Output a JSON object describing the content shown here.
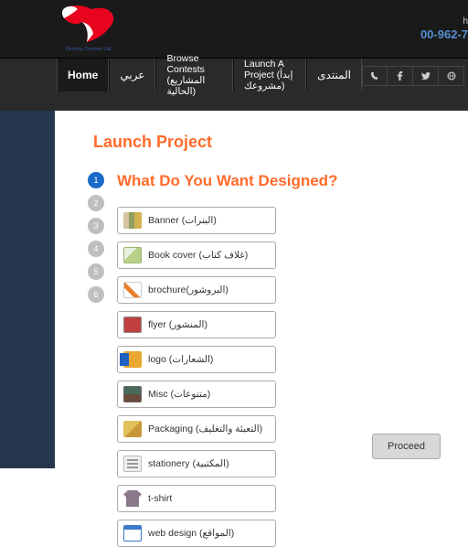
{
  "header": {
    "company": "Destiny Contest Ltd.",
    "phone": "00-962-7",
    "topright": "h"
  },
  "nav": {
    "items": [
      "Home",
      "عربي",
      "Browse Contests (المشاريع الحالية)",
      "Launch A Project (إبدأ مشروعك)",
      "المنتدى"
    ]
  },
  "page": {
    "title": "Launch Project",
    "step_title": "What Do You Want Designed?",
    "proceed": "Proceed"
  },
  "steps": [
    "1",
    "2",
    "3",
    "4",
    "5",
    "6"
  ],
  "categories": [
    {
      "label": "Banner (البنرات)",
      "thumb": "banner"
    },
    {
      "label": "Book cover (غلاف كتاب)",
      "thumb": "book"
    },
    {
      "label": "brochure(البروشور)",
      "thumb": "brochure"
    },
    {
      "label": "flyer (المنشور)",
      "thumb": "flyer"
    },
    {
      "label": "logo (الشعارات)",
      "thumb": "logo"
    },
    {
      "label": "Misc (متنوعات)",
      "thumb": "misc"
    },
    {
      "label": "Packaging (التعبئة والتغليف)",
      "thumb": "packaging"
    },
    {
      "label": "stationery (المكتبية)",
      "thumb": "stationery"
    },
    {
      "label": "t-shirt",
      "thumb": "tshirt"
    },
    {
      "label": "web design (المواقع)",
      "thumb": "web"
    }
  ]
}
